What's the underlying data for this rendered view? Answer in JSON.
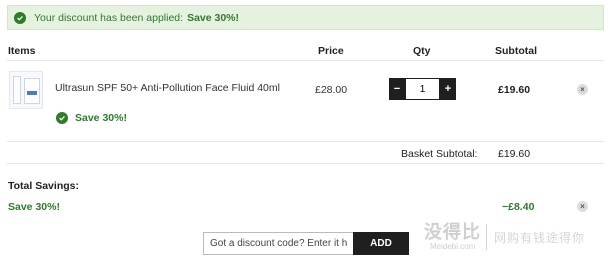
{
  "banner": {
    "message": "Your discount has been applied:",
    "promo": "Save 30%!"
  },
  "columns": {
    "items": "Items",
    "price": "Price",
    "qty": "Qty",
    "subtotal": "Subtotal"
  },
  "item": {
    "name": "Ultrasun SPF 50+ Anti-Pollution Face Fluid 40ml",
    "promo": "Save 30%!",
    "price": "£28.00",
    "qty": "1",
    "decrement": "−",
    "increment": "+",
    "subtotal": "£19.60",
    "remove": "×"
  },
  "basket": {
    "label": "Basket Subtotal:",
    "value": "£19.60"
  },
  "savings": {
    "label": "Total Savings:",
    "promo": "Save 30%!",
    "value": "−£8.40",
    "remove": "×"
  },
  "discount": {
    "placeholder": "Got a discount code? Enter it here",
    "button": "ADD"
  },
  "watermark": {
    "logo": "没得比",
    "site": "Meidebi.com",
    "slogan": "网购有钱途得你"
  },
  "colors": {
    "green": "#2f7a2a",
    "banner_bg": "#e6f2e0",
    "dark": "#1f1f1f"
  },
  "icons": {
    "check": "check-circle-icon",
    "remove": "close-circle-icon"
  }
}
